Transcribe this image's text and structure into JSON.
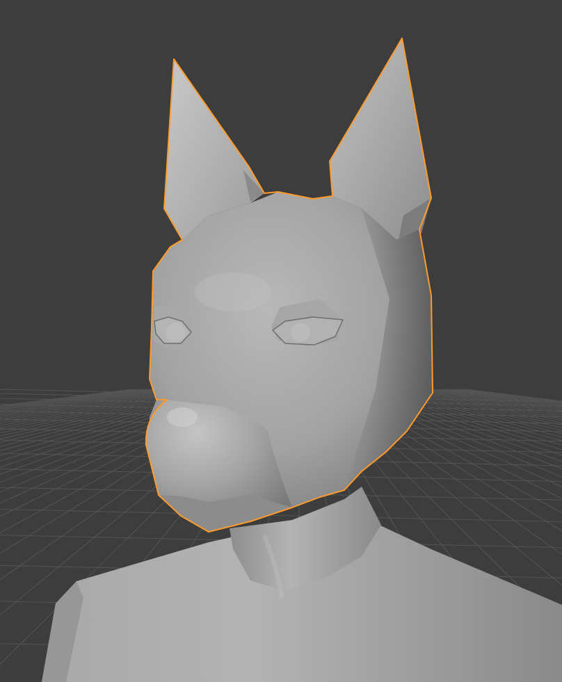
{
  "viewport": {
    "background": "#3d3d3d",
    "grid_color": "#555555",
    "selection_outline_color": "#ff9b2c",
    "mesh_base_color": "#9a9a9a",
    "shading": "solid"
  },
  "scene_objects": [
    {
      "id": "fox-head",
      "selected": true
    },
    {
      "id": "body-bust",
      "selected": false
    }
  ]
}
